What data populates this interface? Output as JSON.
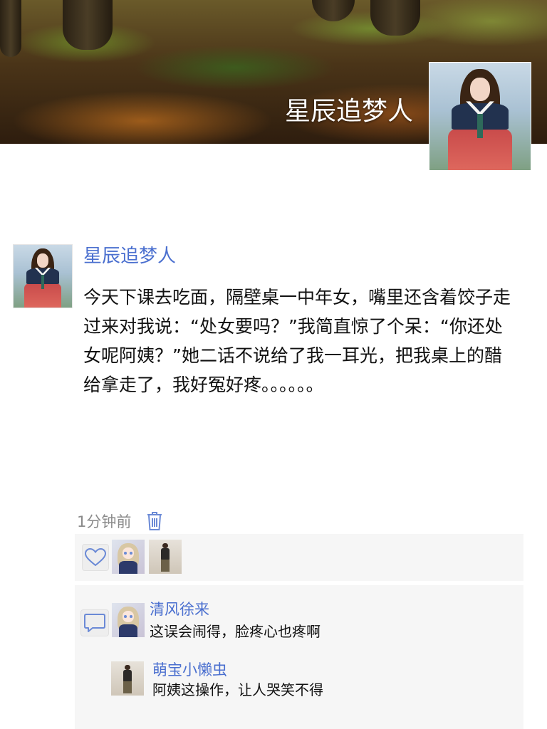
{
  "cover": {
    "title": "星辰追梦人",
    "avatar_icon": "profile-photo-hanbok"
  },
  "post": {
    "author": "星辰追梦人",
    "text": "今天下课去吃面，隔壁桌一中年女，嘴里还含着饺子走过来对我说：“处女要吗？”我简直惊了个呆：“你还处女呢阿姨？”她二话不说给了我一耳光，把我桌上的醋给拿走了，我好冤好疼。。。。。。",
    "time": "1分钟前",
    "delete_icon": "trash-icon"
  },
  "likes": {
    "icon": "heart-icon",
    "users": [
      "anime-girl-avatar",
      "standing-figure-avatar"
    ]
  },
  "comments": {
    "icon": "comment-bubble-icon",
    "items": [
      {
        "name": "清风徐来",
        "text": "这误会闹得，脸疼心也疼啊"
      },
      {
        "name": "萌宝小懒虫",
        "text": "阿姨这操作，让人哭笑不得"
      }
    ]
  },
  "colors": {
    "link_blue": "#4a6fcf",
    "text": "#111111",
    "muted": "#8a8a8a",
    "panel_bg": "#f6f6f6"
  }
}
